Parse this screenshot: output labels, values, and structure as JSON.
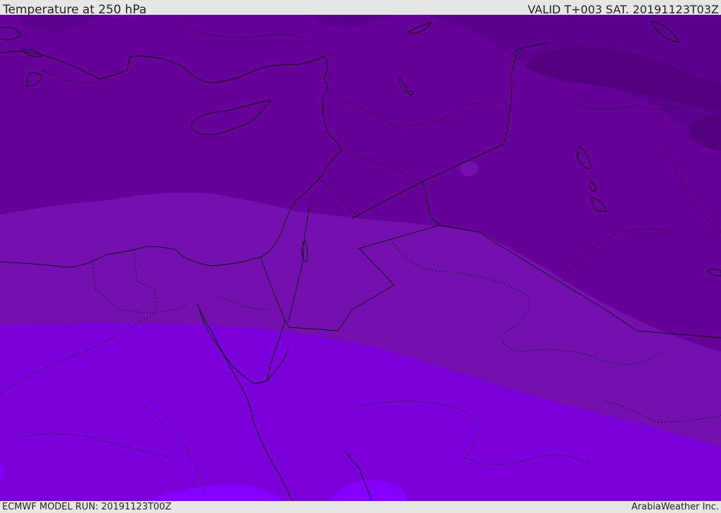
{
  "header": {
    "title": "Temperature at 250 hPa",
    "valid_time": "VALID T+003 SAT. 20191123T03Z"
  },
  "footer": {
    "model_run": "ECMWF MODEL RUN: 20191123T00Z",
    "credit": "ArabiaWeather Inc."
  },
  "map": {
    "colors": {
      "coldest": "#4f007a",
      "very_cold": "#5c0090",
      "cold": "#660099",
      "mid": "#7510b0",
      "warm": "#7b00da",
      "warmest": "#8400ff",
      "coastline": "#111111",
      "border": "#111111"
    }
  }
}
